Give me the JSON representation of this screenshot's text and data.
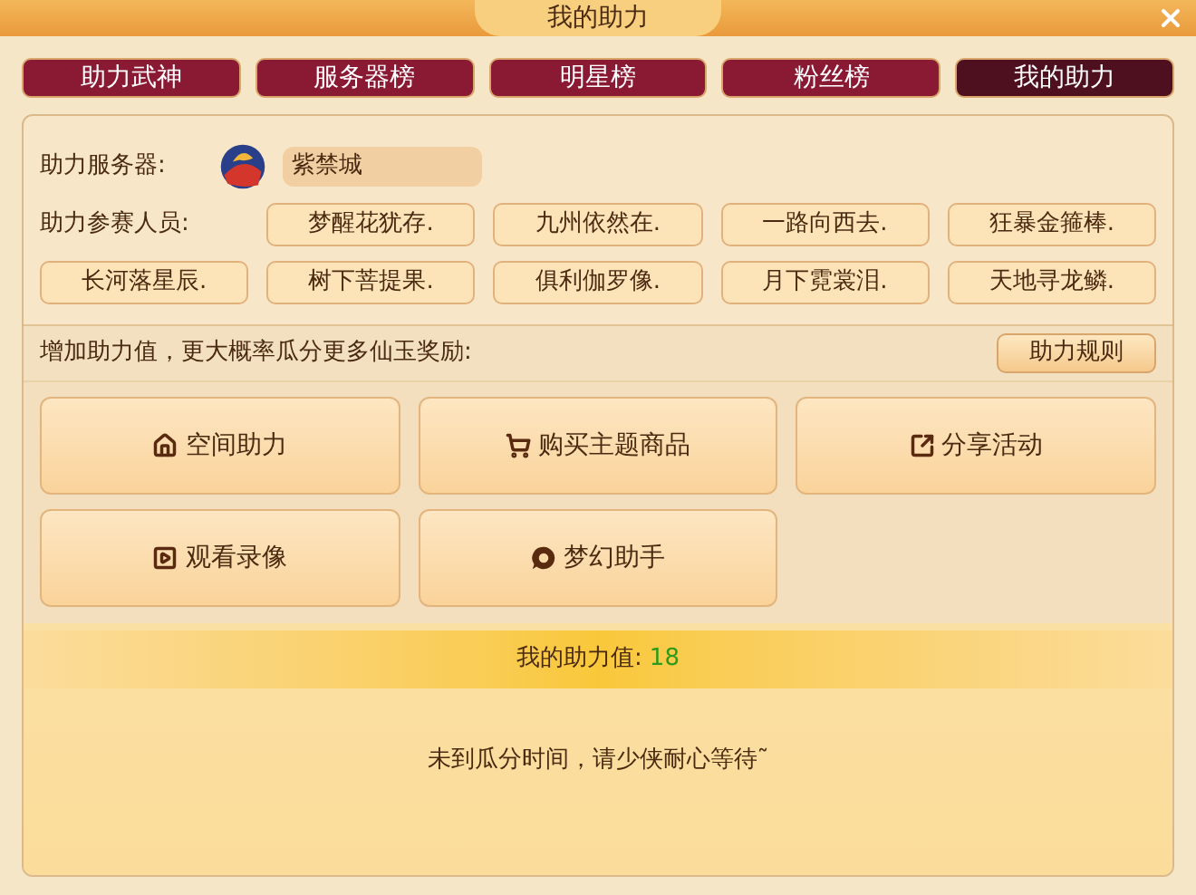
{
  "window": {
    "title": "我的助力"
  },
  "tabs": [
    {
      "label": "助力武神",
      "selected": false
    },
    {
      "label": "服务器榜",
      "selected": false
    },
    {
      "label": "明星榜",
      "selected": false
    },
    {
      "label": "粉丝榜",
      "selected": false
    },
    {
      "label": "我的助力",
      "selected": true
    }
  ],
  "server": {
    "label": "助力服务器:",
    "name": "紫禁城"
  },
  "participants": {
    "label": "助力参赛人员:",
    "names": [
      "梦醒花犹存.",
      "九州依然在.",
      "一路向西去.",
      "狂暴金箍棒.",
      "长河落星辰.",
      "树下菩提果.",
      "俱利伽罗像.",
      "月下霓裳泪.",
      "天地寻龙鳞."
    ]
  },
  "boost": {
    "prompt": "增加助力值，更大概率瓜分更多仙玉奖励:",
    "rules_button": "助力规则"
  },
  "actions": [
    {
      "kind": "home",
      "label": "空间助力"
    },
    {
      "kind": "cart",
      "label": "购买主题商品"
    },
    {
      "kind": "share",
      "label": "分享活动"
    },
    {
      "kind": "video",
      "label": "观看录像"
    },
    {
      "kind": "assistant",
      "label": "梦幻助手"
    }
  ],
  "my_value": {
    "label": "我的助力值:",
    "value": "18"
  },
  "message": "未到瓜分时间，请少侠耐心等待˜"
}
